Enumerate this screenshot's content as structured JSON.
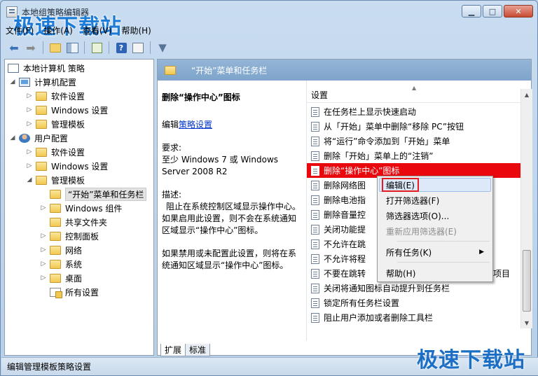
{
  "window": {
    "title": "本地组策略编辑器",
    "minimize": "▭",
    "maximize": "□",
    "close": "✕"
  },
  "watermark": "极速下载站",
  "menu": [
    "文件(F)",
    "操作(A)",
    "查看(V)",
    "帮助(H)"
  ],
  "toolbar": {
    "back_icon": "arrow-left-icon",
    "forward_icon": "arrow-right-icon",
    "help_label": "?"
  },
  "tree": {
    "root": "本地计算机 策略",
    "computer": "计算机配置",
    "computer_children": [
      "软件设置",
      "Windows 设置",
      "管理模板"
    ],
    "user": "用户配置",
    "user_children": [
      "软件设置",
      "Windows 设置",
      "管理模板"
    ],
    "admin_children": [
      "“开始”菜单和任务栏",
      "Windows 组件",
      "共享文件夹",
      "控制面板",
      "网络",
      "系统",
      "桌面",
      "所有设置"
    ]
  },
  "right_header": "“开始”菜单和任务栏",
  "description": {
    "title": "删除“操作中心”图标",
    "edit_prefix": "编辑",
    "edit_link": "策略设置",
    "req_label": "要求:",
    "req_text": "至少 Windows 7 或 Windows Server 2008 R2",
    "desc_label": "描述:",
    "desc_text1": "阻止在系统控制区域显示操作中心。如果启用此设置，则不会在系统通知区域显示“操作中心”图标。",
    "desc_text2": "如果禁用或未配置此设置，则将在系统通知区域显示“操作中心”图标。"
  },
  "list": {
    "header": "设置",
    "rows": [
      "在任务栏上显示快速启动",
      "从「开始」菜单中删除“移除 PC”按钮",
      "将“运行”命令添加到「开始」菜单",
      "删除「开始」菜单上的“注销”",
      "删除“操作中心”图标",
      "删除网络图",
      "删除电池指",
      "删除音量控",
      "关闭功能提",
      "不允许在跳",
      "不允许将程",
      "不要在跳转",
      "关闭将通知图标自动提升到任务栏",
      "锁定所有任务栏设置",
      "阻止用户添加或者删除工具栏"
    ],
    "row12_tail": "项目"
  },
  "context_menu": {
    "edit": "编辑(E)",
    "open_filter": "打开筛选器(F)",
    "filter_options": "筛选器选项(O)...",
    "reapply_filter": "重新应用筛选器(E)",
    "all_tasks": "所有任务(K)",
    "help": "帮助(H)"
  },
  "tabs": [
    "扩展",
    "标准"
  ],
  "status": "编辑管理模板策略设置",
  "colors": {
    "highlight": "#e8080e",
    "link": "#0033cc",
    "header": "#7ea4cb"
  }
}
